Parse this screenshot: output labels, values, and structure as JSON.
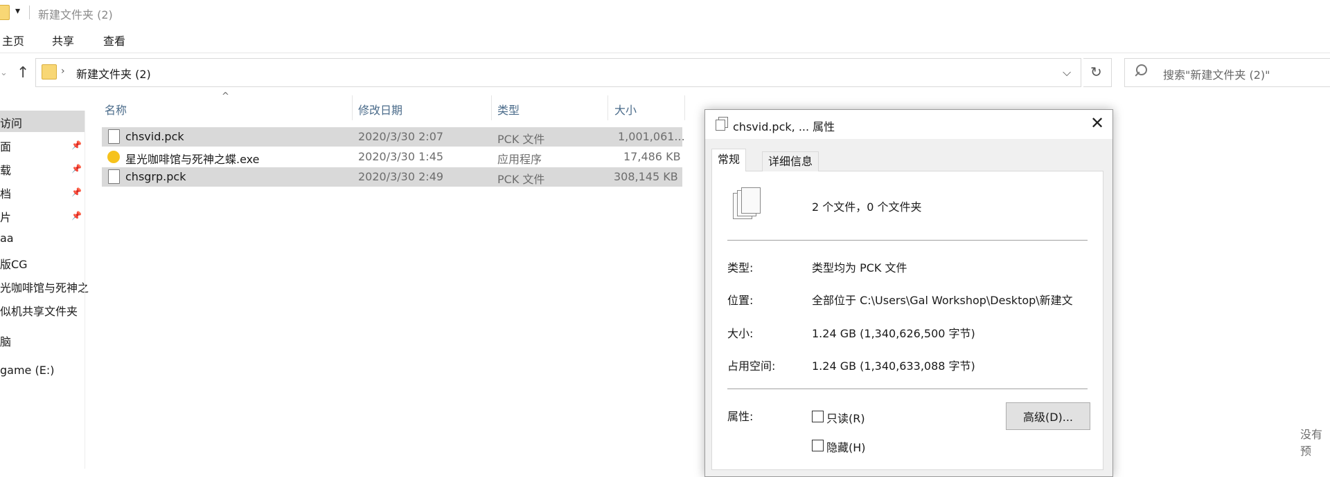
{
  "window": {
    "title": "新建文件夹 (2)",
    "title_dropdown_glyph": "▾"
  },
  "ribbon": {
    "tabs": [
      "主页",
      "共享",
      "查看"
    ]
  },
  "address": {
    "path_arrow": "›",
    "path": "新建文件夹 (2)",
    "dropdown_glyph": "⌵",
    "refresh_glyph": "↻",
    "nav_up_glyph": "↑",
    "nav_back_glyph": "⌄",
    "search_placeholder": "搜索\"新建文件夹 (2)\""
  },
  "nav_pane": {
    "items": [
      {
        "label": "访问",
        "pinned": false
      },
      {
        "label": "面",
        "pinned": true
      },
      {
        "label": "载",
        "pinned": true
      },
      {
        "label": "档",
        "pinned": true
      },
      {
        "label": "片",
        "pinned": true
      },
      {
        "label": "aa",
        "pinned": false
      },
      {
        "label": "版CG",
        "pinned": false
      },
      {
        "label": "光咖啡馆与死神之",
        "pinned": false
      },
      {
        "label": "似机共享文件夹",
        "pinned": false
      },
      {
        "label": "脑",
        "pinned": false
      },
      {
        "label": "game (E:)",
        "pinned": false
      }
    ],
    "pin_glyph": "📌"
  },
  "file_list": {
    "columns": [
      "名称",
      "修改日期",
      "类型",
      "大小"
    ],
    "sort_glyph": "^",
    "rows": [
      {
        "name": "chsvid.pck",
        "modified": "2020/3/30 2:07",
        "type": "PCK 文件",
        "size": "1,001,061...",
        "selected": true,
        "icon": "file-icon"
      },
      {
        "name": "星光咖啡馆与死神之蝶.exe",
        "modified": "2020/3/30 1:45",
        "type": "应用程序",
        "size": "17,486 KB",
        "selected": false,
        "icon": "app-icon"
      },
      {
        "name": "chsgrp.pck",
        "modified": "2020/3/30 2:49",
        "type": "PCK 文件",
        "size": "308,145 KB",
        "selected": true,
        "icon": "file-icon"
      }
    ]
  },
  "properties_dialog": {
    "title": "chsvid.pck, ... 属性",
    "close_glyph": "✕",
    "tabs": [
      "常规",
      "详细信息"
    ],
    "summary": "2 个文件，0 个文件夹",
    "fields": [
      {
        "label": "类型:",
        "value": "类型均为 PCK 文件"
      },
      {
        "label": "位置:",
        "value": "全部位于 C:\\Users\\Gal Workshop\\Desktop\\新建文"
      },
      {
        "label": "大小:",
        "value": "1.24 GB (1,340,626,500 字节)"
      },
      {
        "label": "占用空间:",
        "value": "1.24 GB (1,340,633,088 字节)"
      }
    ],
    "attributes_label": "属性:",
    "readonly_label": "只读(R)",
    "hidden_label": "隐藏(H)",
    "advanced_button": "高级(D)..."
  },
  "preview_pane_note": "没有预"
}
